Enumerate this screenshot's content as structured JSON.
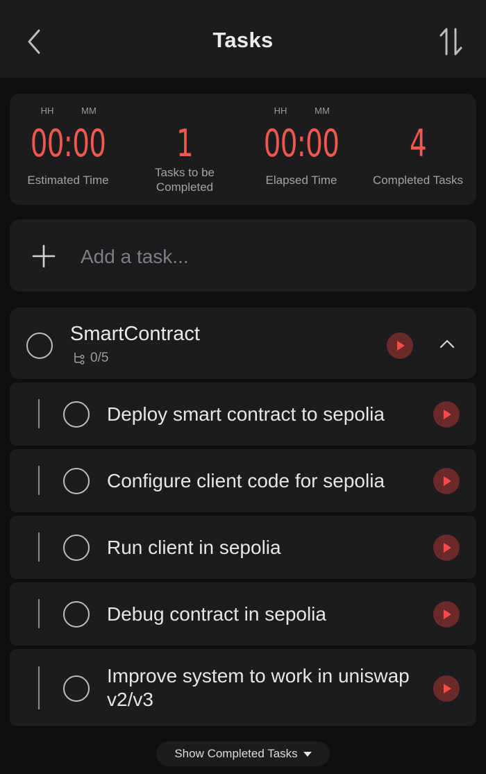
{
  "header": {
    "title": "Tasks",
    "back_icon": "chevron-left-icon",
    "sort_icon": "sort-arrows-icon"
  },
  "stats": {
    "estimated": {
      "units": [
        "HH",
        "MM"
      ],
      "value": "00:00",
      "label": "Estimated Time"
    },
    "to_complete": {
      "value": "1",
      "label": "Tasks to be Completed"
    },
    "elapsed": {
      "units": [
        "HH",
        "MM"
      ],
      "value": "00:00",
      "label": "Elapsed Time"
    },
    "completed": {
      "value": "4",
      "label": "Completed Tasks"
    },
    "accent_color": "#f0574d"
  },
  "add_task": {
    "placeholder": "Add a task...",
    "icon": "plus-icon"
  },
  "project": {
    "name": "SmartContract",
    "subtask_progress": "0/5",
    "subtask_icon": "subtask-tree-icon",
    "collapse_icon": "chevron-up-icon"
  },
  "tasks": [
    {
      "text": "Deploy smart contract to sepolia"
    },
    {
      "text": "Configure client code for sepolia"
    },
    {
      "text": "Run client in sepolia"
    },
    {
      "text": "Debug contract in sepolia"
    },
    {
      "text": "Improve system to work in uniswap v2/v3"
    }
  ],
  "footer": {
    "show_completed_label": "Show Completed Tasks",
    "caret_icon": "caret-down-icon"
  }
}
